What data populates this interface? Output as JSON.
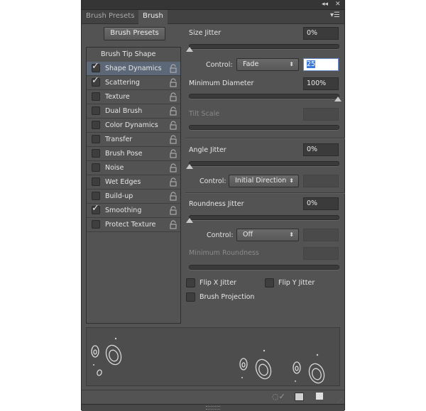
{
  "window": {
    "collapse_icon": "double-chevron-left-icon",
    "close_icon": "close-icon"
  },
  "tabs": [
    {
      "label": "Brush Presets",
      "active": false
    },
    {
      "label": "Brush",
      "active": true
    }
  ],
  "panel_menu_icon": "panel-menu-icon",
  "brush_presets_button": "Brush Presets",
  "sidebar": {
    "header": "Brush Tip Shape",
    "items": [
      {
        "label": "Shape Dynamics",
        "checked": true,
        "selected": true
      },
      {
        "label": "Scattering",
        "checked": true,
        "selected": false
      },
      {
        "label": "Texture",
        "checked": false,
        "selected": false
      },
      {
        "label": "Dual Brush",
        "checked": false,
        "selected": false
      },
      {
        "label": "Color Dynamics",
        "checked": false,
        "selected": false
      },
      {
        "label": "Transfer",
        "checked": false,
        "selected": false
      },
      {
        "label": "Brush Pose",
        "checked": false,
        "selected": false
      },
      {
        "label": "Noise",
        "checked": false,
        "selected": false
      },
      {
        "label": "Wet Edges",
        "checked": false,
        "selected": false
      },
      {
        "label": "Build-up",
        "checked": false,
        "selected": false
      },
      {
        "label": "Smoothing",
        "checked": true,
        "selected": false
      },
      {
        "label": "Protect Texture",
        "checked": false,
        "selected": false
      }
    ]
  },
  "settings": {
    "size_jitter": {
      "label": "Size Jitter",
      "value": "0%",
      "slider_percent": 0
    },
    "size_control": {
      "label": "Control:",
      "value": "Fade",
      "fade_steps": "25"
    },
    "minimum_diameter": {
      "label": "Minimum Diameter",
      "value": "100%",
      "slider_percent": 100
    },
    "tilt_scale": {
      "label": "Tilt Scale",
      "value": "",
      "disabled": true
    },
    "angle_jitter": {
      "label": "Angle Jitter",
      "value": "0%",
      "slider_percent": 0
    },
    "angle_control": {
      "label": "Control:",
      "value": "Initial Direction"
    },
    "roundness_jitter": {
      "label": "Roundness Jitter",
      "value": "0%",
      "slider_percent": 0
    },
    "roundness_control": {
      "label": "Control:",
      "value": "Off"
    },
    "minimum_roundness": {
      "label": "Minimum Roundness",
      "value": "",
      "disabled": true
    },
    "flip_x": {
      "label": "Flip X Jitter",
      "checked": false
    },
    "flip_y": {
      "label": "Flip Y Jitter",
      "checked": false
    },
    "brush_projection": {
      "label": "Brush Projection",
      "checked": false
    }
  },
  "footer": {
    "icons": [
      "toggle-live-tip-preview-icon",
      "open-preset-manager-icon",
      "create-new-brush-icon"
    ]
  }
}
